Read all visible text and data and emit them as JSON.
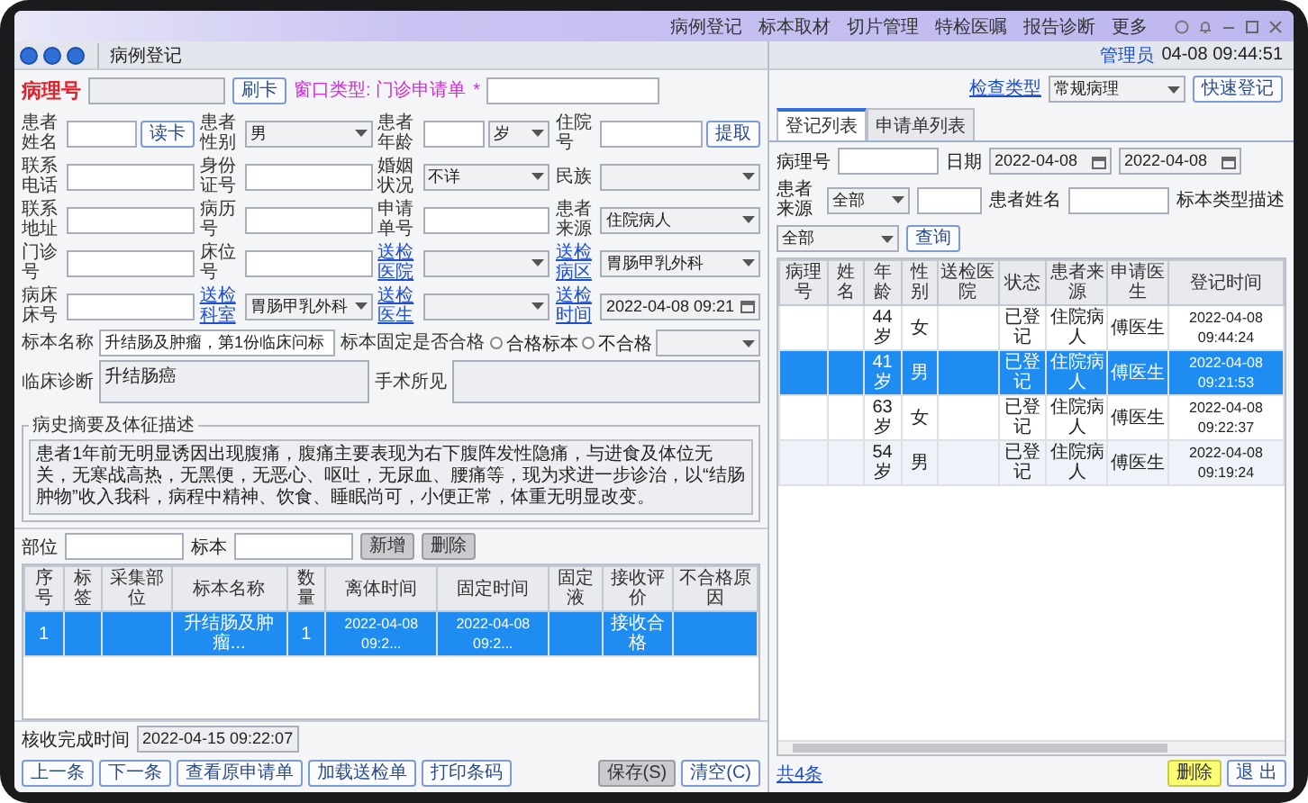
{
  "window": {
    "title": "病例登记",
    "menu": [
      {
        "label": "病例登记"
      },
      {
        "label": "标本取材"
      },
      {
        "label": "切片管理"
      },
      {
        "label": "特检医嘱"
      },
      {
        "label": "报告诊断"
      },
      {
        "label": "更多"
      }
    ]
  },
  "user": {
    "name": "管理员",
    "time": "04-08 09:44:51"
  },
  "header": {
    "pathology_label": "病理号",
    "card_button": "刷卡",
    "window_type": "窗口类型: 门诊申请单",
    "required_mark": "*",
    "exam_type_label": "检查类型",
    "exam_type": "常规病理",
    "quick_button": "快速登记"
  },
  "form_rows": [
    [
      {
        "label": "患者姓名",
        "link": false,
        "controls": [
          {
            "kind": "field"
          },
          {
            "kind": "button",
            "text": "读卡"
          }
        ]
      },
      {
        "label": "患者性别",
        "link": false,
        "controls": [
          {
            "kind": "select",
            "value": "男"
          }
        ]
      },
      {
        "label": "患者年龄",
        "link": false,
        "controls": [
          {
            "kind": "field"
          },
          {
            "kind": "select",
            "value": "岁"
          }
        ]
      },
      {
        "label": "住院号",
        "link": false,
        "controls": [
          {
            "kind": "field"
          },
          {
            "kind": "button",
            "text": "提取"
          }
        ]
      }
    ],
    [
      {
        "label": "联系电话",
        "link": false,
        "controls": [
          {
            "kind": "field"
          }
        ]
      },
      {
        "label": "身份证号",
        "link": false,
        "controls": [
          {
            "kind": "field"
          }
        ]
      },
      {
        "label": "婚姻状况",
        "link": false,
        "controls": [
          {
            "kind": "select",
            "value": "不详"
          }
        ]
      },
      {
        "label": "民族",
        "link": false,
        "controls": [
          {
            "kind": "select"
          }
        ]
      }
    ],
    [
      {
        "label": "联系地址",
        "link": false,
        "controls": [
          {
            "kind": "field"
          }
        ]
      },
      {
        "label": "病历号",
        "link": false,
        "controls": [
          {
            "kind": "field"
          }
        ]
      },
      {
        "label": "申请单号",
        "link": false,
        "controls": [
          {
            "kind": "field"
          }
        ]
      },
      {
        "label": "患者来源",
        "link": false,
        "controls": [
          {
            "kind": "select",
            "value": "住院病人"
          }
        ]
      }
    ],
    [
      {
        "label": "门诊号",
        "link": false,
        "controls": [
          {
            "kind": "field"
          }
        ]
      },
      {
        "label": "床位号",
        "link": false,
        "controls": [
          {
            "kind": "field"
          }
        ]
      },
      {
        "label": "送检医院",
        "link": true,
        "controls": [
          {
            "kind": "select"
          }
        ]
      },
      {
        "label": "送检病区",
        "link": true,
        "controls": [
          {
            "kind": "select",
            "value": "胃肠甲乳外科"
          }
        ]
      }
    ],
    [
      {
        "label": "病床床号",
        "link": false,
        "controls": [
          {
            "kind": "field"
          }
        ]
      },
      {
        "label": "送检科室",
        "link": true,
        "controls": [
          {
            "kind": "select",
            "value": "胃肠甲乳外科"
          }
        ]
      },
      {
        "label": "送检医生",
        "link": true,
        "controls": [
          {
            "kind": "select"
          }
        ]
      },
      {
        "label": "送检时间",
        "link": true,
        "controls": [
          {
            "kind": "date",
            "value": "2022-04-08 09:21"
          }
        ]
      }
    ],
    [
      {
        "label": "标本名称",
        "link": false,
        "controls": [
          {
            "kind": "field",
            "value": "升结肠及肿瘤，第1份临床问标"
          }
        ]
      },
      {
        "label": "标本固定是否合格",
        "link": false,
        "controls": [
          {
            "kind": "radio",
            "text": "合格标本",
            "selected": false
          },
          {
            "kind": "radio",
            "text": "不合格",
            "selected": false
          },
          {
            "kind": "select"
          }
        ]
      }
    ],
    [
      {
        "label": "临床诊断",
        "link": false,
        "controls": [
          {
            "kind": "textarea",
            "value": "升结肠癌"
          }
        ]
      },
      {
        "label": "手术所见",
        "link": false,
        "controls": [
          {
            "kind": "textarea"
          }
        ]
      }
    ]
  ],
  "history": {
    "title": "病史摘要及体征描述",
    "text": "患者1年前无明显诱因出现腹痛，腹痛主要表现为右下腹阵发性隐痛，与进食及体位无关，无寒战高热，无黑便，无恶心、呕吐，无尿血、腰痛等，现为求进一步诊治，以“结肠肿物”收入我科，病程中精神、饮食、睡眠尚可，小便正常，体重无明显改变。"
  },
  "parts_bar": {
    "site_label": "部位",
    "specimen_label": "标本",
    "buttons": [
      "新增",
      "删除"
    ]
  },
  "specimen_table": {
    "columns": [
      "序号",
      "标签",
      "采集部位",
      "标本名称",
      "数量",
      "离体时间",
      "固定时间",
      "固定液",
      "接收评价",
      "不合格原因"
    ],
    "rows": [
      {
        "selected": true,
        "number": "1",
        "specimen_name": "升结肠及肿瘤...",
        "quantity": "1",
        "excised_time": "2022-04-08 09:2...",
        "fixed_time": "2022-04-08 09:2...",
        "evaluation": "接收合格"
      }
    ]
  },
  "completion": {
    "label": "核收完成时间",
    "value": "2022-04-15 09:22:07"
  },
  "left_buttons": [
    {
      "label": "上一条",
      "kind": "plain"
    },
    {
      "label": "下一条",
      "kind": "plain"
    },
    {
      "label": "查看原申请单",
      "kind": "plain"
    },
    {
      "label": "加载送检单",
      "kind": "plain"
    },
    {
      "label": "打印条码",
      "kind": "plain"
    }
  ],
  "right_buttons_left": [
    {
      "label": "保存(S)",
      "kind": "gray"
    },
    {
      "label": "清空(C)",
      "kind": "plain"
    }
  ],
  "list_panel": {
    "tabs": [
      {
        "label": "登记列表",
        "selected": true
      },
      {
        "label": "申请单列表",
        "selected": false
      }
    ],
    "filters": {
      "pathology_label": "病理号",
      "date_label": "日期",
      "date_from": "2022-04-08",
      "date_to": "2022-04-08",
      "source_label": "患者来源",
      "source": "全部",
      "name_label": "患者姓名",
      "type_label": "标本类型描述",
      "type": "全部",
      "query_button": "查询"
    },
    "columns": [
      "病理号",
      "姓名",
      "年龄",
      "性别",
      "送检医院",
      "状态",
      "患者来源",
      "申请医生",
      "登记时间"
    ],
    "rows": [
      {
        "selected": false,
        "age": "44岁",
        "sex": "女",
        "status": "已登记",
        "source": "住院病人",
        "doctor": "傅医生",
        "registered": "2022-04-08 09:44:24"
      },
      {
        "selected": true,
        "age": "41岁",
        "sex": "男",
        "status": "已登记",
        "source": "住院病人",
        "doctor": "傅医生",
        "registered": "2022-04-08 09:21:53"
      },
      {
        "selected": false,
        "age": "63岁",
        "sex": "女",
        "status": "已登记",
        "source": "住院病人",
        "doctor": "傅医生",
        "registered": "2022-04-08 09:22:37"
      },
      {
        "selected": false,
        "age": "54岁",
        "sex": "男",
        "status": "已登记",
        "source": "住院病人",
        "doctor": "傅医生",
        "registered": "2022-04-08 09:19:24"
      }
    ],
    "count": "共4条",
    "buttons": [
      {
        "label": "删除",
        "kind": "highlight"
      },
      {
        "label": "退 出",
        "kind": "plain"
      }
    ]
  }
}
